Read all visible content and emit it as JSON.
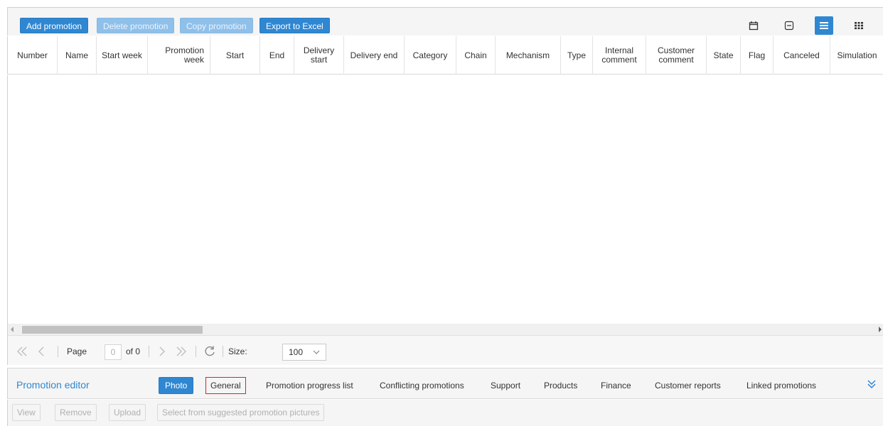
{
  "toolbar": {
    "buttons": [
      {
        "label": "Add promotion",
        "state": "enabled"
      },
      {
        "label": "Delete promotion",
        "state": "disabled"
      },
      {
        "label": "Copy promotion",
        "state": "disabled"
      },
      {
        "label": "Export to Excel",
        "state": "enabled"
      }
    ],
    "view_icons": [
      "calendar-icon",
      "collapse-box-icon",
      "list-view-icon",
      "grid-view-icon"
    ],
    "active_view": "list-view-icon"
  },
  "grid": {
    "columns": [
      "Number",
      "Name",
      "Start week",
      "Promotion week",
      "Start",
      "End",
      "Delivery start",
      "Delivery end",
      "Category",
      "Chain",
      "Mechanism",
      "Type",
      "Internal comment",
      "Customer comment",
      "State",
      "Flag",
      "Canceled",
      "Simulation"
    ],
    "rows": []
  },
  "pager": {
    "page_label": "Page",
    "page_value": "0",
    "of_label": "of 0",
    "size_label": "Size:",
    "size_value": "100"
  },
  "editor": {
    "title": "Promotion editor",
    "tabs": [
      "Photo",
      "General",
      "Promotion progress list",
      "Conflicting promotions",
      "Support",
      "Products",
      "Finance",
      "Customer reports",
      "Linked promotions"
    ],
    "active_tab": "Photo",
    "highlighted_tab": "General",
    "actions": [
      "View",
      "Remove",
      "Upload",
      "Select from suggested promotion pictures"
    ]
  },
  "colors": {
    "accent": "#2f87d2",
    "highlight": "#e02020"
  }
}
